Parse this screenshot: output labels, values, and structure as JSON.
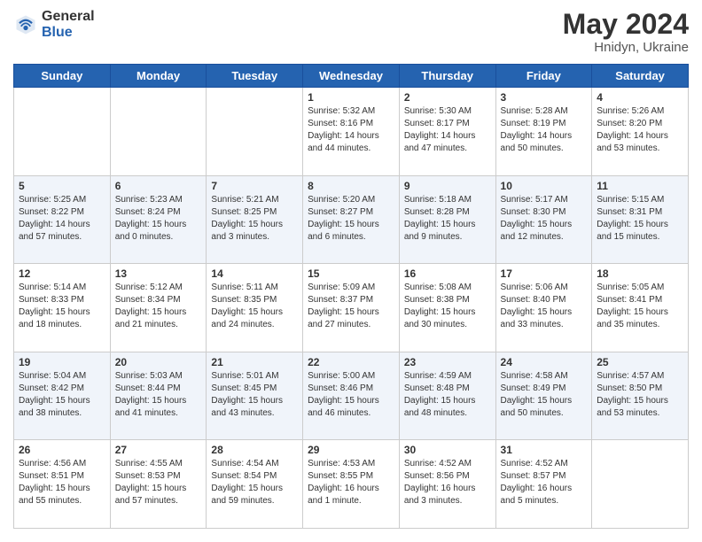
{
  "logo": {
    "general": "General",
    "blue": "Blue"
  },
  "header": {
    "title": "May 2024",
    "subtitle": "Hnidyn, Ukraine"
  },
  "weekdays": [
    "Sunday",
    "Monday",
    "Tuesday",
    "Wednesday",
    "Thursday",
    "Friday",
    "Saturday"
  ],
  "weeks": [
    [
      {
        "day": "",
        "sunrise": "",
        "sunset": "",
        "daylight": ""
      },
      {
        "day": "",
        "sunrise": "",
        "sunset": "",
        "daylight": ""
      },
      {
        "day": "",
        "sunrise": "",
        "sunset": "",
        "daylight": ""
      },
      {
        "day": "1",
        "sunrise": "Sunrise: 5:32 AM",
        "sunset": "Sunset: 8:16 PM",
        "daylight": "Daylight: 14 hours and 44 minutes."
      },
      {
        "day": "2",
        "sunrise": "Sunrise: 5:30 AM",
        "sunset": "Sunset: 8:17 PM",
        "daylight": "Daylight: 14 hours and 47 minutes."
      },
      {
        "day": "3",
        "sunrise": "Sunrise: 5:28 AM",
        "sunset": "Sunset: 8:19 PM",
        "daylight": "Daylight: 14 hours and 50 minutes."
      },
      {
        "day": "4",
        "sunrise": "Sunrise: 5:26 AM",
        "sunset": "Sunset: 8:20 PM",
        "daylight": "Daylight: 14 hours and 53 minutes."
      }
    ],
    [
      {
        "day": "5",
        "sunrise": "Sunrise: 5:25 AM",
        "sunset": "Sunset: 8:22 PM",
        "daylight": "Daylight: 14 hours and 57 minutes."
      },
      {
        "day": "6",
        "sunrise": "Sunrise: 5:23 AM",
        "sunset": "Sunset: 8:24 PM",
        "daylight": "Daylight: 15 hours and 0 minutes."
      },
      {
        "day": "7",
        "sunrise": "Sunrise: 5:21 AM",
        "sunset": "Sunset: 8:25 PM",
        "daylight": "Daylight: 15 hours and 3 minutes."
      },
      {
        "day": "8",
        "sunrise": "Sunrise: 5:20 AM",
        "sunset": "Sunset: 8:27 PM",
        "daylight": "Daylight: 15 hours and 6 minutes."
      },
      {
        "day": "9",
        "sunrise": "Sunrise: 5:18 AM",
        "sunset": "Sunset: 8:28 PM",
        "daylight": "Daylight: 15 hours and 9 minutes."
      },
      {
        "day": "10",
        "sunrise": "Sunrise: 5:17 AM",
        "sunset": "Sunset: 8:30 PM",
        "daylight": "Daylight: 15 hours and 12 minutes."
      },
      {
        "day": "11",
        "sunrise": "Sunrise: 5:15 AM",
        "sunset": "Sunset: 8:31 PM",
        "daylight": "Daylight: 15 hours and 15 minutes."
      }
    ],
    [
      {
        "day": "12",
        "sunrise": "Sunrise: 5:14 AM",
        "sunset": "Sunset: 8:33 PM",
        "daylight": "Daylight: 15 hours and 18 minutes."
      },
      {
        "day": "13",
        "sunrise": "Sunrise: 5:12 AM",
        "sunset": "Sunset: 8:34 PM",
        "daylight": "Daylight: 15 hours and 21 minutes."
      },
      {
        "day": "14",
        "sunrise": "Sunrise: 5:11 AM",
        "sunset": "Sunset: 8:35 PM",
        "daylight": "Daylight: 15 hours and 24 minutes."
      },
      {
        "day": "15",
        "sunrise": "Sunrise: 5:09 AM",
        "sunset": "Sunset: 8:37 PM",
        "daylight": "Daylight: 15 hours and 27 minutes."
      },
      {
        "day": "16",
        "sunrise": "Sunrise: 5:08 AM",
        "sunset": "Sunset: 8:38 PM",
        "daylight": "Daylight: 15 hours and 30 minutes."
      },
      {
        "day": "17",
        "sunrise": "Sunrise: 5:06 AM",
        "sunset": "Sunset: 8:40 PM",
        "daylight": "Daylight: 15 hours and 33 minutes."
      },
      {
        "day": "18",
        "sunrise": "Sunrise: 5:05 AM",
        "sunset": "Sunset: 8:41 PM",
        "daylight": "Daylight: 15 hours and 35 minutes."
      }
    ],
    [
      {
        "day": "19",
        "sunrise": "Sunrise: 5:04 AM",
        "sunset": "Sunset: 8:42 PM",
        "daylight": "Daylight: 15 hours and 38 minutes."
      },
      {
        "day": "20",
        "sunrise": "Sunrise: 5:03 AM",
        "sunset": "Sunset: 8:44 PM",
        "daylight": "Daylight: 15 hours and 41 minutes."
      },
      {
        "day": "21",
        "sunrise": "Sunrise: 5:01 AM",
        "sunset": "Sunset: 8:45 PM",
        "daylight": "Daylight: 15 hours and 43 minutes."
      },
      {
        "day": "22",
        "sunrise": "Sunrise: 5:00 AM",
        "sunset": "Sunset: 8:46 PM",
        "daylight": "Daylight: 15 hours and 46 minutes."
      },
      {
        "day": "23",
        "sunrise": "Sunrise: 4:59 AM",
        "sunset": "Sunset: 8:48 PM",
        "daylight": "Daylight: 15 hours and 48 minutes."
      },
      {
        "day": "24",
        "sunrise": "Sunrise: 4:58 AM",
        "sunset": "Sunset: 8:49 PM",
        "daylight": "Daylight: 15 hours and 50 minutes."
      },
      {
        "day": "25",
        "sunrise": "Sunrise: 4:57 AM",
        "sunset": "Sunset: 8:50 PM",
        "daylight": "Daylight: 15 hours and 53 minutes."
      }
    ],
    [
      {
        "day": "26",
        "sunrise": "Sunrise: 4:56 AM",
        "sunset": "Sunset: 8:51 PM",
        "daylight": "Daylight: 15 hours and 55 minutes."
      },
      {
        "day": "27",
        "sunrise": "Sunrise: 4:55 AM",
        "sunset": "Sunset: 8:53 PM",
        "daylight": "Daylight: 15 hours and 57 minutes."
      },
      {
        "day": "28",
        "sunrise": "Sunrise: 4:54 AM",
        "sunset": "Sunset: 8:54 PM",
        "daylight": "Daylight: 15 hours and 59 minutes."
      },
      {
        "day": "29",
        "sunrise": "Sunrise: 4:53 AM",
        "sunset": "Sunset: 8:55 PM",
        "daylight": "Daylight: 16 hours and 1 minute."
      },
      {
        "day": "30",
        "sunrise": "Sunrise: 4:52 AM",
        "sunset": "Sunset: 8:56 PM",
        "daylight": "Daylight: 16 hours and 3 minutes."
      },
      {
        "day": "31",
        "sunrise": "Sunrise: 4:52 AM",
        "sunset": "Sunset: 8:57 PM",
        "daylight": "Daylight: 16 hours and 5 minutes."
      },
      {
        "day": "",
        "sunrise": "",
        "sunset": "",
        "daylight": ""
      }
    ]
  ]
}
